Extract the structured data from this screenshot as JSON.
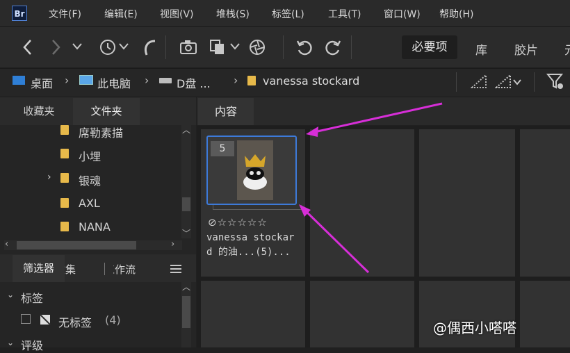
{
  "app": {
    "logo_text": "Br"
  },
  "menu": [
    "文件(F)",
    "编辑(E)",
    "视图(V)",
    "堆栈(S)",
    "标签(L)",
    "工具(T)",
    "窗口(W)",
    "帮助(H)"
  ],
  "toolbar": {
    "icons": [
      "back-arrow",
      "forward-arrow",
      "history-clock",
      "boomerang",
      "camera-import",
      "copy-stack",
      "refine-aperture",
      "rotate-left",
      "rotate-right"
    ]
  },
  "workspaces": [
    "必要项",
    "库",
    "胶片",
    "元"
  ],
  "breadcrumb": [
    "桌面",
    "此电脑",
    "D盘 ...",
    "vanessa stockard"
  ],
  "left_panel": {
    "tabs": [
      "收藏夹",
      "文件夹"
    ],
    "folders": [
      "席勒素描",
      "小埋",
      "银魂",
      "AXL",
      "NANA"
    ],
    "lower_tabs": [
      "筛选器",
      "收集",
      "工作流"
    ],
    "filter_sections": [
      {
        "title": "标签",
        "items": [
          {
            "label": "无标签",
            "count": "(4)"
          }
        ]
      },
      {
        "title": "评级"
      }
    ]
  },
  "content": {
    "tab": "内容",
    "thumbnail": {
      "badge": "5",
      "rating": "⊘☆☆☆☆☆",
      "name_line1": "vanessa stockar",
      "name_line2": "d 的油...(5)..."
    }
  },
  "watermark": "@偶西小嗒嗒",
  "colors": {
    "accent_blue": "#3d7ad9",
    "folder_yellow": "#e7b94a",
    "annotation_arrow": "#d72ed8"
  }
}
